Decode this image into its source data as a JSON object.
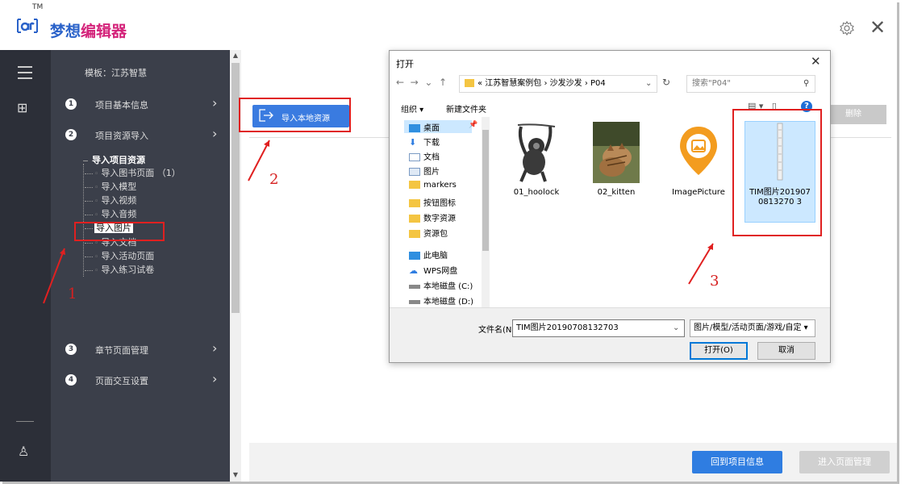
{
  "header": {
    "logo_tm": "TM",
    "logo_a": "梦想",
    "logo_b": "编辑器"
  },
  "nav": {
    "template_label": "模板：江苏智慧",
    "steps": [
      {
        "num": "1",
        "label": "项目基本信息"
      },
      {
        "num": "2",
        "label": "项目资源导入"
      },
      {
        "num": "3",
        "label": "章节页面管理"
      },
      {
        "num": "4",
        "label": "页面交互设置"
      }
    ],
    "tree_head": "导入项目资源",
    "tree_items": [
      "导入图书页面 （1）",
      "导入模型",
      "导入视频",
      "导入音频",
      "导入图片",
      "导入文档",
      "导入活动页面",
      "导入练习试卷"
    ],
    "selected_item": "导入图片"
  },
  "main": {
    "import_label": "导入本地资源",
    "delete_label": "删除",
    "back_label": "回到项目信息",
    "enter_label": "进入页面管理"
  },
  "annotations": [
    "1",
    "2",
    "3"
  ],
  "dialog": {
    "title": "打开",
    "breadcrumb": "« 江苏智慧案例包 › 沙发沙发 › P04",
    "search_placeholder": "搜索\"P04\"",
    "organize": "组织 ▾",
    "new_folder": "新建文件夹",
    "tree": [
      {
        "label": "桌面",
        "icon": "desktop"
      },
      {
        "label": "下载",
        "icon": "download"
      },
      {
        "label": "文档",
        "icon": "document"
      },
      {
        "label": "图片",
        "icon": "picture"
      },
      {
        "label": "markers",
        "icon": "folder"
      },
      {
        "label": "按钮图标",
        "icon": "folder"
      },
      {
        "label": "数字资源",
        "icon": "folder"
      },
      {
        "label": "资源包",
        "icon": "folder"
      },
      {
        "label": "此电脑",
        "icon": "pc"
      },
      {
        "label": "WPS网盘",
        "icon": "cloud"
      },
      {
        "label": "本地磁盘 (C:)",
        "icon": "drive"
      },
      {
        "label": "本地磁盘 (D:)",
        "icon": "drive"
      }
    ],
    "files": [
      {
        "name": "01_hoolock"
      },
      {
        "name": "02_kitten"
      },
      {
        "name": "ImagePicture"
      },
      {
        "name": "TIM图片2019070813270 3"
      }
    ],
    "filename_label": "文件名(N):",
    "filename_value": "TIM图片20190708132703",
    "filter_value": "图片/模型/活动页面/游戏/自定 ▾",
    "open_label": "打开(O)",
    "cancel_label": "取消"
  },
  "colors": {
    "accent": "#3a7be0",
    "rail": "#2c2f38",
    "nav": "#3b3f4a",
    "annotation": "#e02020"
  }
}
